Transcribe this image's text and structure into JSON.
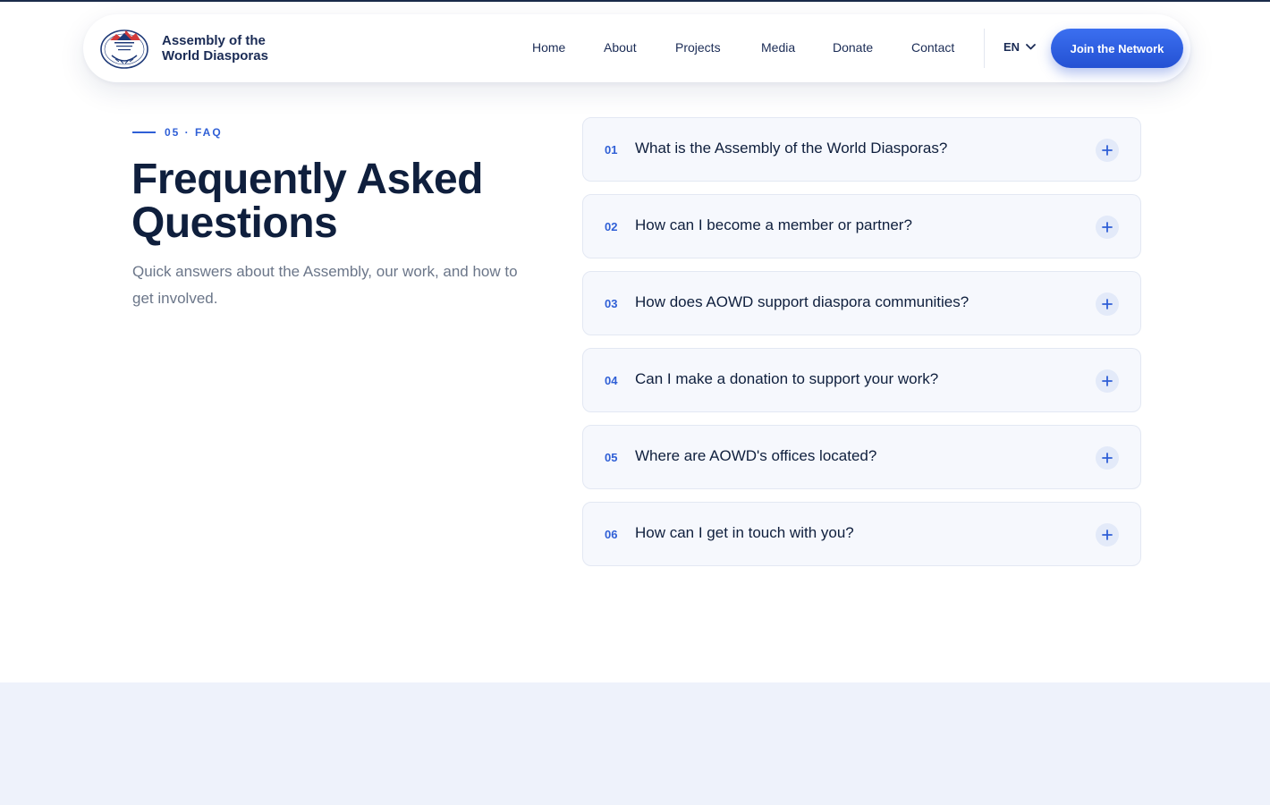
{
  "brand": {
    "name": "Assembly of the World Diasporas",
    "logo_text": "ASSEMBLY OF THE WORLD DIASPORAS"
  },
  "nav": {
    "items": [
      "Home",
      "About",
      "Projects",
      "Media",
      "Donate",
      "Contact"
    ],
    "language": "EN",
    "cta": "Join the Network"
  },
  "section": {
    "kicker": "05 · FAQ",
    "title": "Frequently Asked Questions",
    "subtitle": "Quick answers about the Assembly, our work, and how to get involved."
  },
  "faqs": [
    {
      "number": "01",
      "question": "What is the Assembly of the World Diasporas?"
    },
    {
      "number": "02",
      "question": "How can I become a member or partner?"
    },
    {
      "number": "03",
      "question": "How does AOWD support diaspora communities?"
    },
    {
      "number": "04",
      "question": "Can I make a donation to support your work?"
    },
    {
      "number": "05",
      "question": "Where are AOWD's offices located?"
    },
    {
      "number": "06",
      "question": "How can I get in touch with you?"
    }
  ],
  "colors": {
    "accent": "#2f5fd6",
    "heading": "#0f1f3d",
    "muted": "#6b7689",
    "card_bg": "#f6f8fd",
    "band_bg": "#eef2fb"
  },
  "icons": {
    "language_toggle": "chevron-down-icon",
    "faq_toggle": "plus-icon"
  }
}
